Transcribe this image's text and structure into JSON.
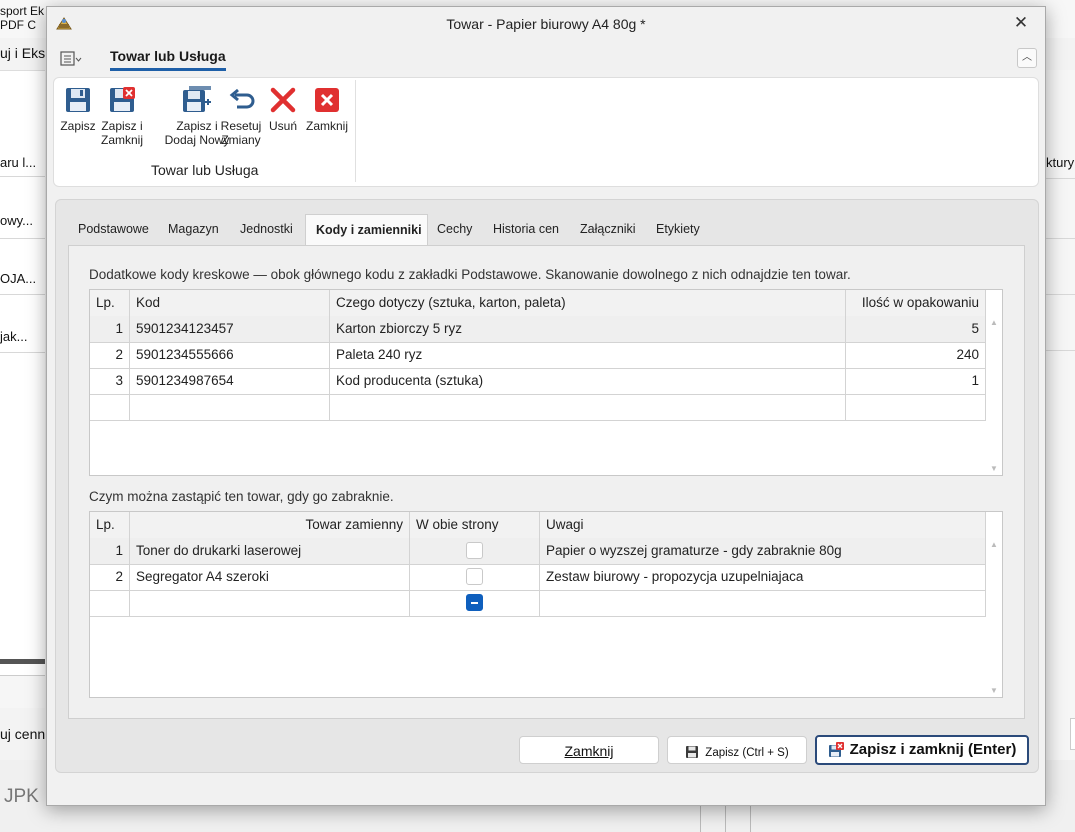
{
  "background": {
    "top_text_1": "sport  Ek",
    "top_text_2": "PDF     C",
    "ribbon_text": "uj i Eksp",
    "header_cell": "aru l...",
    "rows": [
      "owy...",
      "OJA...",
      "jak..."
    ],
    "right_header": "ktury",
    "bottom_left_text": "uj cenn",
    "jpk_text": "JPK"
  },
  "window": {
    "title": "Towar - Papier biurowy A4 80g *",
    "close_icon": "close-icon"
  },
  "ribbon": {
    "tab_label": "Towar lub Usługa",
    "group_label": "Towar lub Usługa",
    "buttons": [
      {
        "label_1": "Zapisz",
        "label_2": "",
        "icon": "save-icon"
      },
      {
        "label_1": "Zapisz i",
        "label_2": "Zamknij",
        "icon": "save-close-icon"
      },
      {
        "label_1": "Zapisz i",
        "label_2": "Dodaj Nowy",
        "icon": "save-new-icon"
      },
      {
        "label_1": "Resetuj",
        "label_2": "Zmiany",
        "icon": "undo-icon"
      },
      {
        "label_1": "Usuń",
        "label_2": "",
        "icon": "delete-icon"
      },
      {
        "label_1": "Zamknij",
        "label_2": "",
        "icon": "close-red-icon"
      }
    ]
  },
  "tabs": [
    {
      "label": "Podstawowe",
      "active": false
    },
    {
      "label": "Magazyn",
      "active": false
    },
    {
      "label": "Jednostki",
      "active": false
    },
    {
      "label": "Kody i zamienniki",
      "active": true
    },
    {
      "label": "Cechy",
      "active": false
    },
    {
      "label": "Historia cen",
      "active": false
    },
    {
      "label": "Załączniki",
      "active": false
    },
    {
      "label": "Etykiety",
      "active": false
    }
  ],
  "barcodes": {
    "description": "Dodatkowe kody kreskowe — obok głównego kodu z zakładki Podstawowe. Skanowanie dowolnego z nich odnajdzie ten towar.",
    "columns": [
      "Lp.",
      "Kod",
      "Czego dotyczy (sztuka, karton, paleta)",
      "Ilość w opakowaniu"
    ],
    "rows": [
      {
        "lp": "1",
        "code": "5901234123457",
        "desc": "Karton zbiorczy 5 ryz",
        "qty": "5"
      },
      {
        "lp": "2",
        "code": "5901234555666",
        "desc": "Paleta 240 ryz",
        "qty": "240"
      },
      {
        "lp": "3",
        "code": "5901234987654",
        "desc": "Kod producenta (sztuka)",
        "qty": "1"
      }
    ]
  },
  "substitutes": {
    "description": "Czym można zastąpić ten towar, gdy go zabraknie.",
    "columns": [
      "Lp.",
      "Towar zamienny",
      "W obie strony",
      "Uwagi"
    ],
    "rows": [
      {
        "lp": "1",
        "name": "Toner do drukarki laserowej",
        "both_ways": false,
        "notes": "Papier o wyzszej gramaturze - gdy zabraknie 80g"
      },
      {
        "lp": "2",
        "name": "Segregator A4 szeroki",
        "both_ways": false,
        "notes": "Zestaw biurowy - propozycja uzupelniajaca"
      }
    ],
    "new_row_both_ways": "indeterminate"
  },
  "footer": {
    "close_label": "Zamknij",
    "save_label": "Zapisz (Ctrl + S)",
    "save_close_label": "Zapisz i zamknij (Enter)"
  },
  "colors": {
    "accent": "#1e5fa8",
    "checkbox_indeterminate": "#0f5fbd",
    "save_icon": "#2f5d8f",
    "delete_red": "#e03030"
  }
}
